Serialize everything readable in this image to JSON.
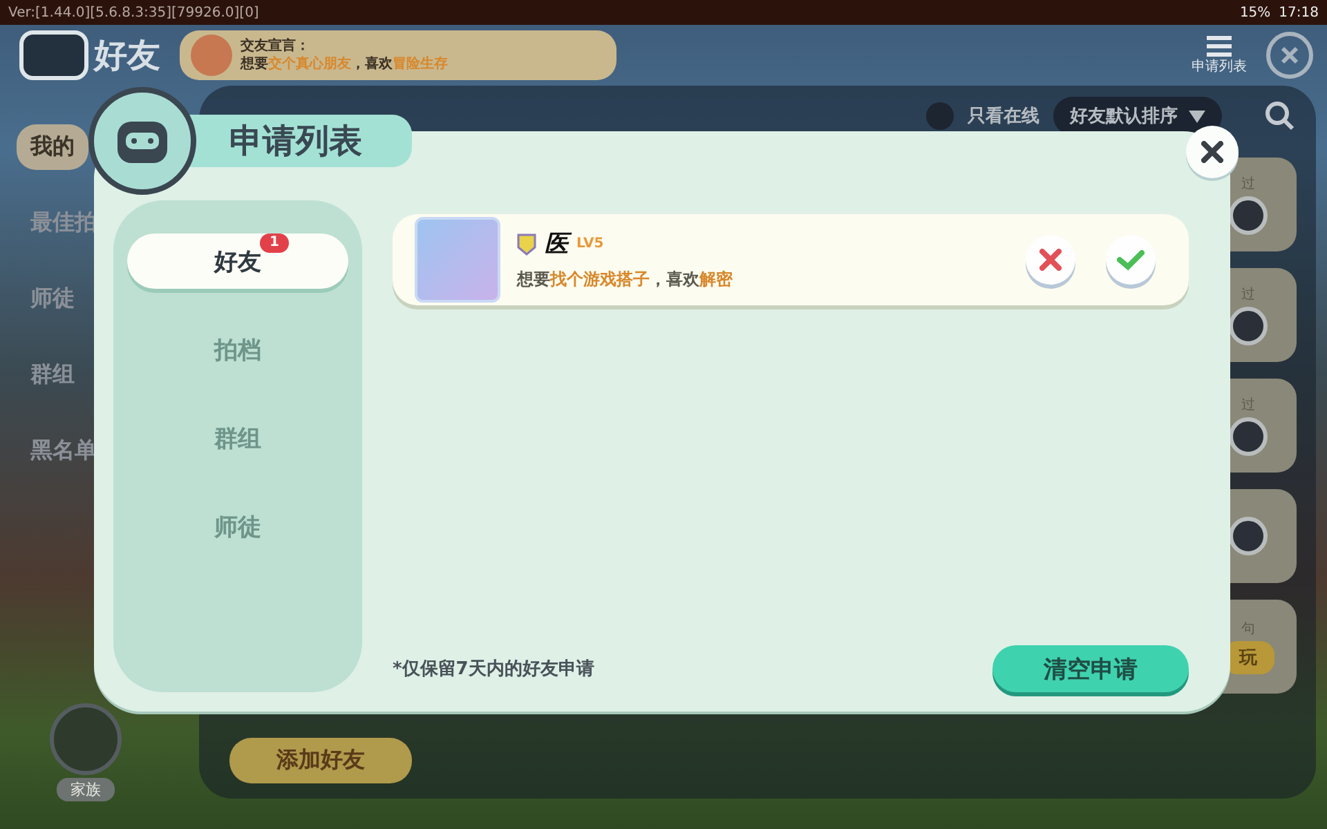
{
  "status_bar": {
    "version": "Ver:[1.44.0][5.6.8.3:35][79926.0][0]",
    "battery": "15%",
    "time": "17:18"
  },
  "header": {
    "title": "好友",
    "declaration_label": "交友宣言：",
    "declaration": [
      {
        "text": "想要",
        "highlight": false
      },
      {
        "text": "交个真心朋友",
        "highlight": true
      },
      {
        "text": "，喜欢",
        "highlight": false
      },
      {
        "text": "冒险生存",
        "highlight": true
      }
    ],
    "apply_list": "申请列表"
  },
  "sidebar": [
    {
      "label": "我的",
      "selected": true
    },
    {
      "label": "最佳拍",
      "selected": false
    },
    {
      "label": "师徒",
      "selected": false
    },
    {
      "label": "群组",
      "selected": false
    },
    {
      "label": "黑名单",
      "selected": false
    }
  ],
  "toolbar": {
    "online_only": {
      "label": "只看在线",
      "checked": false
    },
    "sort": "好友默认排序"
  },
  "side_cards": [
    {
      "kind": "more",
      "label": "过"
    },
    {
      "kind": "more",
      "label": "过"
    },
    {
      "kind": "more",
      "label": "过"
    },
    {
      "kind": "more"
    },
    {
      "kind": "play",
      "label": "句",
      "button": "玩"
    }
  ],
  "add_friend": "添加好友",
  "family": "家族",
  "dialog": {
    "title": "申请列表",
    "tabs": [
      {
        "label": "好友",
        "selected": true,
        "badge": "1"
      },
      {
        "label": "拍档",
        "selected": false
      },
      {
        "label": "群组",
        "selected": false
      },
      {
        "label": "师徒",
        "selected": false
      }
    ],
    "requests": [
      {
        "name": "医",
        "level": "LV5",
        "message": [
          {
            "text": "想要",
            "highlight": false
          },
          {
            "text": "找个游戏搭子",
            "highlight": true
          },
          {
            "text": "，喜欢",
            "highlight": false
          },
          {
            "text": "解密",
            "highlight": true
          }
        ]
      }
    ],
    "note": "*仅保留7天内的好友申请",
    "clear_button": "清空申请"
  }
}
